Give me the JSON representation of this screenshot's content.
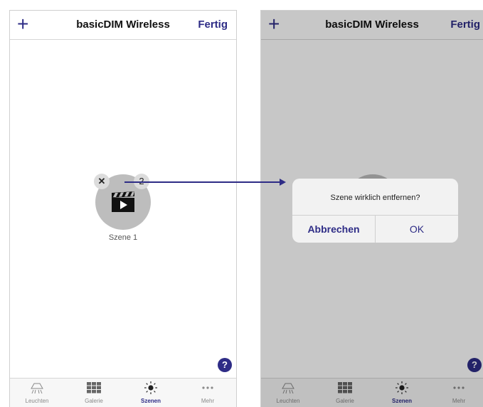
{
  "left": {
    "navbar": {
      "plus": "+",
      "title": "basicDIM Wireless",
      "done": "Fertig"
    },
    "scene": {
      "label": "Szene 1",
      "delete_badge": "✕",
      "number_badge": "2"
    },
    "help": "?",
    "tabs": [
      {
        "label": "Leuchten",
        "icon": "lamp-icon"
      },
      {
        "label": "Galerie",
        "icon": "grid-icon"
      },
      {
        "label": "Szenen",
        "icon": "sun-icon",
        "active": true
      },
      {
        "label": "Mehr",
        "icon": "more-dots-icon"
      }
    ]
  },
  "right": {
    "navbar": {
      "plus": "+",
      "title": "basicDIM Wireless",
      "done": "Fertig"
    },
    "alert": {
      "message": "Szene wirklich entfernen?",
      "cancel": "Abbrechen",
      "ok": "OK"
    },
    "help": "?",
    "tabs": [
      {
        "label": "Leuchten",
        "icon": "lamp-icon"
      },
      {
        "label": "Galerie",
        "icon": "grid-icon"
      },
      {
        "label": "Szenen",
        "icon": "sun-icon",
        "active": true
      },
      {
        "label": "Mehr",
        "icon": "more-dots-icon"
      }
    ]
  },
  "colors": {
    "accent": "#2e2c86",
    "scene_circle": "#bdbdbd"
  }
}
